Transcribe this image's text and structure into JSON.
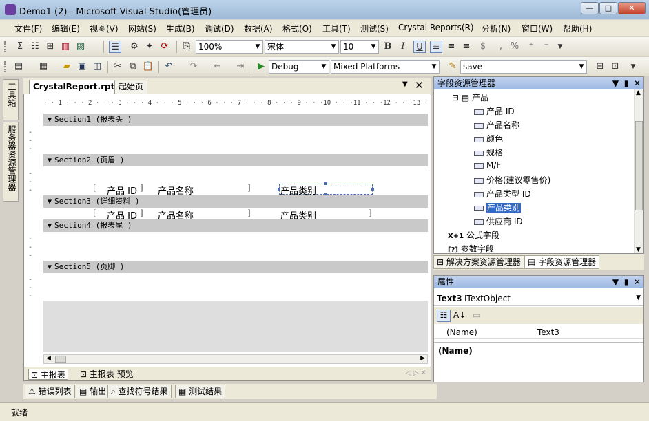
{
  "window": {
    "title": "Demo1 (2) - Microsoft Visual Studio(管理员)",
    "min_label": "—",
    "max_label": "□",
    "close_label": "✕"
  },
  "menu": [
    "文件(F)",
    "编辑(E)",
    "视图(V)",
    "网站(S)",
    "生成(B)",
    "调试(D)",
    "数据(A)",
    "格式(O)",
    "工具(T)",
    "测试(S)",
    "Crystal Reports(R)",
    "分析(N)",
    "窗口(W)",
    "帮助(H)"
  ],
  "toolbar1": {
    "zoom": "100%",
    "font": "宋体",
    "font_size": "10",
    "bold": "B",
    "italic": "I",
    "underline": "U",
    "currency": "$",
    "comma": ",",
    "percent": "%"
  },
  "toolbar2": {
    "config": "Debug",
    "platform": "Mixed Platforms",
    "find": "save"
  },
  "left_strip": {
    "toolbox": "工具箱",
    "server_explorer": "服务器资源管理器"
  },
  "doc_tabs": {
    "active": "CrystalReport.rpt*",
    "start": "起始页",
    "close": "✕",
    "dropdown": "▼"
  },
  "ruler": "· · 1 · · · 2 · · · 3 · · · 4 · · · 5 · · · 6 · · · 7 · · · 8 · · · 9 · · ·10 · · ·11 · · ·12 · · ·13 · · ·14 ·",
  "sections": [
    "Section1 (报表头  )",
    "Section2 (页眉  )",
    "Section3 (详细资料  )",
    "Section4 (报表尾  )",
    "Section5 (页脚  )"
  ],
  "report_fields": {
    "header": [
      "产品 ID",
      "产品名称",
      "产品类别"
    ],
    "detail": [
      "产品 ID",
      "产品名称",
      "产品类别"
    ]
  },
  "view_tabs": [
    "主报表",
    "主报表 预览"
  ],
  "bottom_tabs": [
    "错误列表",
    "输出",
    "查找符号结果",
    "测试结果"
  ],
  "status": "就绪",
  "field_explorer": {
    "title": "字段资源管理器",
    "table": "产品",
    "fields": [
      "产品 ID",
      "产品名称",
      "颜色",
      "规格",
      "M/F",
      "价格(建议零售价)",
      "产品类型 ID",
      "产品类别",
      "供应商 ID"
    ],
    "selected_index": 7,
    "formula": "公式字段",
    "params": "参数字段",
    "formula_icon": "X+1",
    "params_icon": "[?]"
  },
  "panel_tabs": [
    "解决方案资源管理器",
    "字段资源管理器"
  ],
  "properties": {
    "title": "属性",
    "object_name": "Text3",
    "object_type": "ITextObject",
    "row_name": "(Name)",
    "row_value": "Text3",
    "desc_title": "(Name)"
  }
}
